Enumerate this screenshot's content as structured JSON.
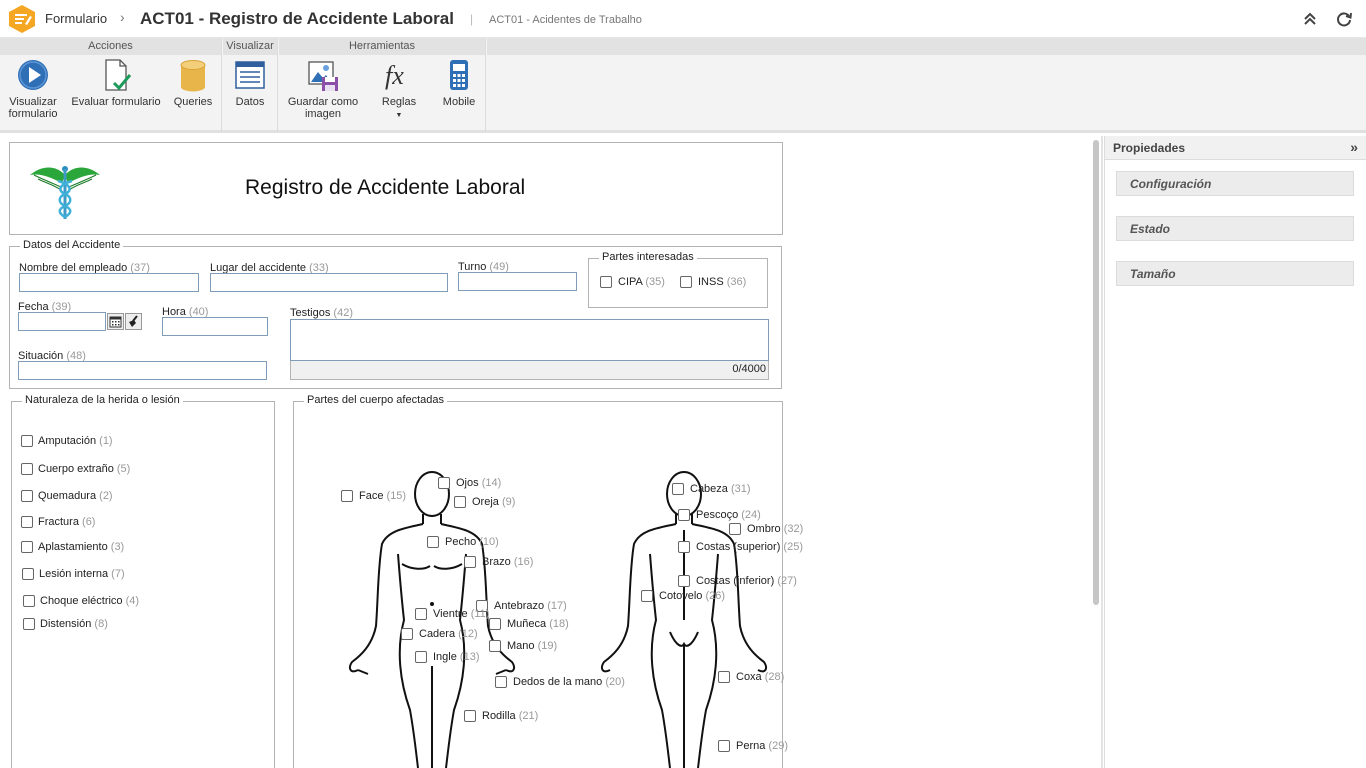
{
  "titlebar": {
    "breadcrumb_root": "Formulario",
    "breadcrumb_sep": "›",
    "title": "ACT01 - Registro de Accidente Laboral",
    "divider": "|",
    "subtitle": "ACT01 - Acidentes de Trabalho"
  },
  "ribbon": {
    "groups": {
      "acciones": "Acciones",
      "visualizar": "Visualizar",
      "herramientas": "Herramientas"
    },
    "buttons": {
      "visualizar_1": "Visualizar",
      "visualizar_2": "formulario",
      "evaluar": "Evaluar formulario",
      "queries": "Queries",
      "datos": "Datos",
      "guardar_1": "Guardar como",
      "guardar_2": "imagen",
      "reglas": "Reglas",
      "mobile": "Mobile"
    }
  },
  "form": {
    "title": "Registro de Accidente Laboral",
    "datos": {
      "legend": "Datos del Accidente",
      "nombre": {
        "label": "Nombre del empleado",
        "num": "(37)"
      },
      "lugar": {
        "label": "Lugar del accidente",
        "num": "(33)"
      },
      "turno": {
        "label": "Turno",
        "num": "(49)"
      },
      "partes_legend": "Partes interesadas",
      "cipa": {
        "label": "CIPA",
        "num": "(35)"
      },
      "inss": {
        "label": "INSS",
        "num": "(36)"
      },
      "fecha": {
        "label": "Fecha",
        "num": "(39)"
      },
      "hora": {
        "label": "Hora",
        "num": "(40)"
      },
      "testigos": {
        "label": "Testigos",
        "num": "(42)"
      },
      "counter": "0/4000",
      "situacion": {
        "label": "Situación",
        "num": "(48)"
      }
    },
    "naturaleza": {
      "legend": "Naturaleza de la herida o lesión",
      "items": [
        {
          "label": "Amputación",
          "num": "(1)"
        },
        {
          "label": "Cuerpo extraño",
          "num": "(5)"
        },
        {
          "label": "Quemadura",
          "num": "(2)"
        },
        {
          "label": "Fractura",
          "num": "(6)"
        },
        {
          "label": "Aplastamiento",
          "num": "(3)"
        },
        {
          "label": "Lesión interna",
          "num": "(7)"
        },
        {
          "label": "Choque eléctrico",
          "num": "(4)"
        },
        {
          "label": "Distensión",
          "num": "(8)"
        }
      ]
    },
    "cuerpo": {
      "legend": "Partes del cuerpo afectadas",
      "items": [
        {
          "label": "Face",
          "num": "(15)"
        },
        {
          "label": "Ojos",
          "num": "(14)"
        },
        {
          "label": "Oreja",
          "num": "(9)"
        },
        {
          "label": "Pecho",
          "num": "(10)"
        },
        {
          "label": "Brazo",
          "num": "(16)"
        },
        {
          "label": "Antebrazo",
          "num": "(17)"
        },
        {
          "label": "Vientre",
          "num": "(11)"
        },
        {
          "label": "Muñeca",
          "num": "(18)"
        },
        {
          "label": "Cadera",
          "num": "(12)"
        },
        {
          "label": "Mano",
          "num": "(19)"
        },
        {
          "label": "Ingle",
          "num": "(13)"
        },
        {
          "label": "Dedos de la mano",
          "num": "(20)"
        },
        {
          "label": "Rodilla",
          "num": "(21)"
        },
        {
          "label": "Cabeza",
          "num": "(31)"
        },
        {
          "label": "Pescoço",
          "num": "(24)"
        },
        {
          "label": "Ombro",
          "num": "(32)"
        },
        {
          "label": "Costas (superior)",
          "num": "(25)"
        },
        {
          "label": "Costas (inferior)",
          "num": "(27)"
        },
        {
          "label": "Cotovelo",
          "num": "(26)"
        },
        {
          "label": "Coxa",
          "num": "(28)"
        },
        {
          "label": "Perna",
          "num": "(29)"
        }
      ]
    }
  },
  "props": {
    "title": "Propiedades",
    "expand": "»",
    "sections": [
      "Configuración",
      "Estado",
      "Tamaño"
    ]
  },
  "colors": {
    "accent_logo": "#f5a623",
    "ribbon_bg": "#f3f3f3",
    "icon_blue": "#2f6fb5",
    "queries_gold": "#e8b54a"
  }
}
